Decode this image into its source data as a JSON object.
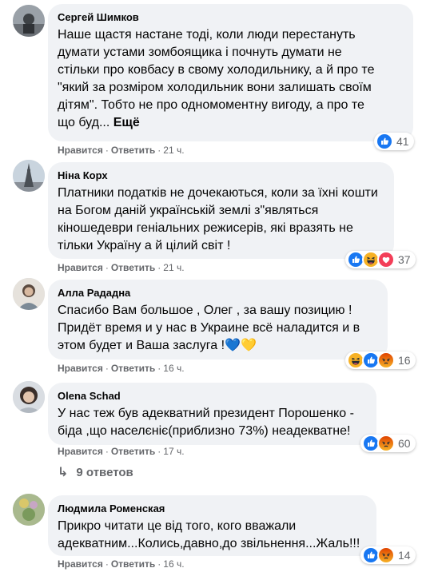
{
  "comments": [
    {
      "author": "Сергей Шимков",
      "text": "Наше щастя настане тоді, коли люди перестануть\nдумати устами зомбоящика і почнуть думати не\nстільки про ковбасу в свому холодильнику, а й про те\n\"який за розміром холодильник вони залишать своїм\nдітям\". Тобто не про одномоментну вигоду, а про те\nщо буд...",
      "more": "Ещё",
      "like": "Нравится",
      "reply": "Ответить",
      "time": "21 ч.",
      "reactions": [
        "like"
      ],
      "count": "41"
    },
    {
      "author": "Ніна Корх",
      "text": "Платники податків не дочекаються, коли за їхні кошти\nна Богом даній українській землі з\"являться\nкіношедеври геніальних режисерів, які вразять не\nтільки Україну а й цілий світ !",
      "like": "Нравится",
      "reply": "Ответить",
      "time": "21 ч.",
      "reactions": [
        "like",
        "haha",
        "love"
      ],
      "count": "37"
    },
    {
      "author": "Алла Рададна",
      "text": "Спасибо Вам большое , Олег , за вашу позицию !\nПридёт время и у нас в Украине всё наладится и в\nэтом будет и Ваша заслуга !💙💛",
      "like": "Нравится",
      "reply": "Ответить",
      "time": "16 ч.",
      "reactions": [
        "haha",
        "like",
        "angry"
      ],
      "count": "16"
    },
    {
      "author": "Olena Schad",
      "text": "У нас теж був адекватний президент Порошенко -\nбіда ,що населєніє(приблизно 73%) неадекватне!",
      "like": "Нравится",
      "reply": "Ответить",
      "time": "17 ч.",
      "reactions": [
        "like",
        "angry"
      ],
      "count": "60",
      "replies": "9 ответов"
    },
    {
      "author": "Людмила Роменская",
      "text": "Прикро читати це від того, кого вважали\nадекватним...Колись,давно,до звільнення...Жаль!!!",
      "like": "Нравится",
      "reply": "Ответить",
      "time": "16 ч.",
      "reactions": [
        "like",
        "angry"
      ],
      "count": "14"
    }
  ],
  "colors": {
    "bubble": "#f0f2f5",
    "like": "#1877f2",
    "love": "#f33e58",
    "haha": "#f7b125",
    "angry": "#e9710f",
    "meta": "#65676b"
  }
}
